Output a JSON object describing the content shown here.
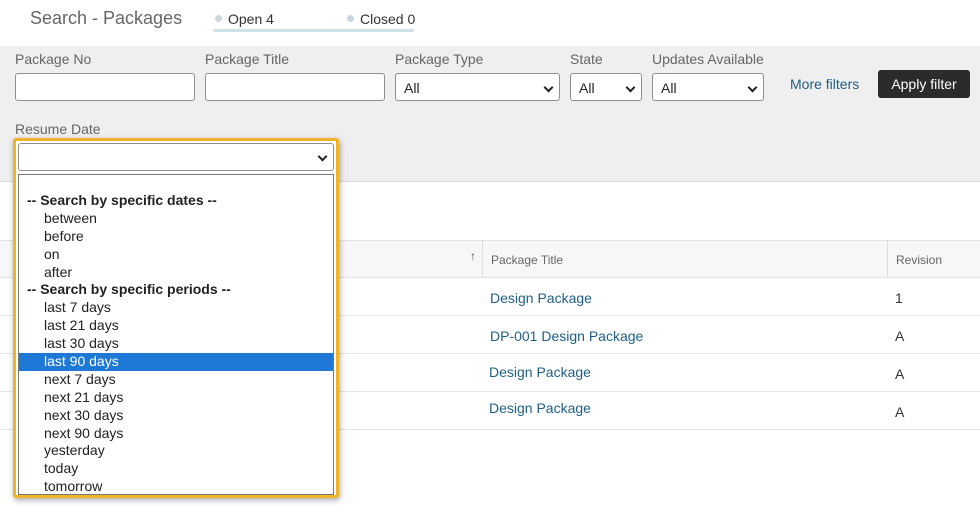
{
  "header": {
    "title": "Search - Packages",
    "tabs": [
      {
        "label": "Open 4"
      },
      {
        "label": "Closed 0"
      }
    ]
  },
  "filters": {
    "package_no_label": "Package No",
    "package_title_label": "Package Title",
    "package_type_label": "Package Type",
    "package_type_value": "All",
    "state_label": "State",
    "state_value": "All",
    "updates_label": "Updates Available",
    "updates_value": "All",
    "more_filters": "More filters",
    "apply_filter": "Apply filter",
    "resume_date_label": "Resume Date",
    "resume_date_value": ""
  },
  "dropdown": {
    "options": [
      {
        "label": "-- Search by specific dates --",
        "group": true
      },
      {
        "label": "between"
      },
      {
        "label": "before"
      },
      {
        "label": "on"
      },
      {
        "label": "after"
      },
      {
        "label": "-- Search by specific periods --",
        "group": true
      },
      {
        "label": "last 7 days"
      },
      {
        "label": "last 21 days"
      },
      {
        "label": "last 30 days"
      },
      {
        "label": "last 90 days",
        "selected": true
      },
      {
        "label": "next 7 days"
      },
      {
        "label": "next 21 days"
      },
      {
        "label": "next 30 days"
      },
      {
        "label": "next 90 days"
      },
      {
        "label": "yesterday"
      },
      {
        "label": "today"
      },
      {
        "label": "tomorrow"
      }
    ],
    "highlight_color": "#1e78d6",
    "frame_color": "#f0b429"
  },
  "table": {
    "columns": {
      "package_title": "Package Title",
      "revision": "Revision"
    },
    "sort_icon": "arrow-up-icon",
    "rows": [
      {
        "title": "Design Package",
        "revision": "1"
      },
      {
        "title": "DP-001 Design Package",
        "revision": "A"
      },
      {
        "title": "Design Package",
        "revision": "A"
      },
      {
        "title": "Design Package",
        "revision": "A"
      }
    ]
  }
}
